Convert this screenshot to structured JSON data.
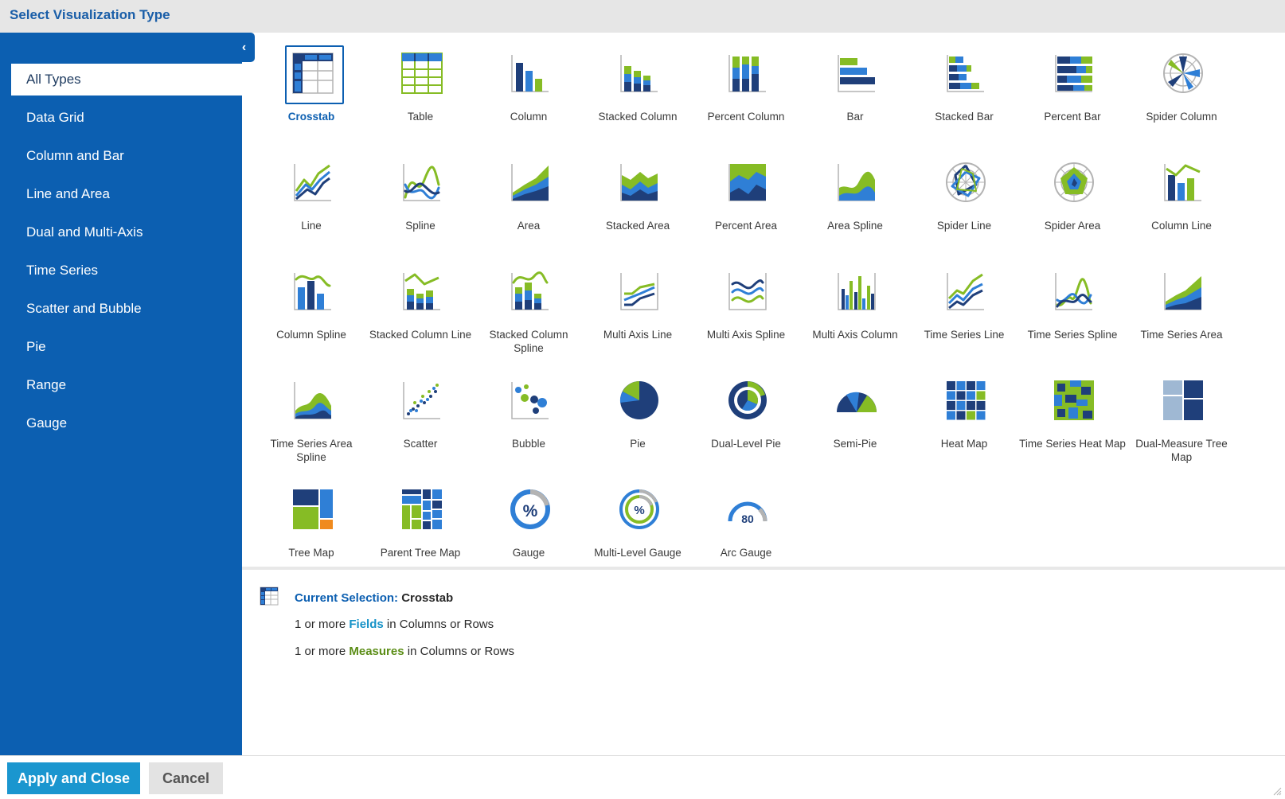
{
  "window": {
    "title": "Select Visualization Type"
  },
  "sidebar": {
    "collapse_glyph": "‹",
    "items": [
      {
        "label": "All Types",
        "active": true
      },
      {
        "label": "Data Grid"
      },
      {
        "label": "Column and Bar"
      },
      {
        "label": "Line and Area"
      },
      {
        "label": "Dual and Multi-Axis"
      },
      {
        "label": "Time Series"
      },
      {
        "label": "Scatter and Bubble"
      },
      {
        "label": "Pie"
      },
      {
        "label": "Range"
      },
      {
        "label": "Gauge"
      }
    ]
  },
  "gallery": {
    "items": [
      {
        "label": "Crosstab",
        "icon": "crosstab-icon",
        "selected": true
      },
      {
        "label": "Table",
        "icon": "table-icon"
      },
      {
        "label": "Column",
        "icon": "column-chart-icon"
      },
      {
        "label": "Stacked Column",
        "icon": "stacked-column-icon"
      },
      {
        "label": "Percent Column",
        "icon": "percent-column-icon"
      },
      {
        "label": "Bar",
        "icon": "bar-chart-icon"
      },
      {
        "label": "Stacked Bar",
        "icon": "stacked-bar-icon"
      },
      {
        "label": "Percent Bar",
        "icon": "percent-bar-icon"
      },
      {
        "label": "Spider Column",
        "icon": "spider-column-icon"
      },
      {
        "label": "Line",
        "icon": "line-chart-icon"
      },
      {
        "label": "Spline",
        "icon": "spline-chart-icon"
      },
      {
        "label": "Area",
        "icon": "area-chart-icon"
      },
      {
        "label": "Stacked Area",
        "icon": "stacked-area-icon"
      },
      {
        "label": "Percent Area",
        "icon": "percent-area-icon"
      },
      {
        "label": "Area Spline",
        "icon": "area-spline-icon"
      },
      {
        "label": "Spider Line",
        "icon": "spider-line-icon"
      },
      {
        "label": "Spider Area",
        "icon": "spider-area-icon"
      },
      {
        "label": "Column Line",
        "icon": "column-line-icon"
      },
      {
        "label": "Column Spline",
        "icon": "column-spline-icon"
      },
      {
        "label": "Stacked Column Line",
        "icon": "stacked-column-line-icon"
      },
      {
        "label": "Stacked Column Spline",
        "icon": "stacked-column-spline-icon"
      },
      {
        "label": "Multi Axis Line",
        "icon": "multi-axis-line-icon"
      },
      {
        "label": "Multi Axis Spline",
        "icon": "multi-axis-spline-icon"
      },
      {
        "label": "Multi Axis Column",
        "icon": "multi-axis-column-icon"
      },
      {
        "label": "Time Series Line",
        "icon": "time-series-line-icon"
      },
      {
        "label": "Time Series Spline",
        "icon": "time-series-spline-icon"
      },
      {
        "label": "Time Series Area",
        "icon": "time-series-area-icon"
      },
      {
        "label": "Time Series Area Spline",
        "icon": "time-series-area-spline-icon"
      },
      {
        "label": "Scatter",
        "icon": "scatter-chart-icon"
      },
      {
        "label": "Bubble",
        "icon": "bubble-chart-icon"
      },
      {
        "label": "Pie",
        "icon": "pie-chart-icon"
      },
      {
        "label": "Dual-Level Pie",
        "icon": "dual-level-pie-icon"
      },
      {
        "label": "Semi-Pie",
        "icon": "semi-pie-icon"
      },
      {
        "label": "Heat Map",
        "icon": "heat-map-icon"
      },
      {
        "label": "Time Series Heat Map",
        "icon": "time-series-heat-map-icon"
      },
      {
        "label": "Dual-Measure Tree Map",
        "icon": "dual-measure-tree-map-icon"
      },
      {
        "label": "Tree Map",
        "icon": "tree-map-icon"
      },
      {
        "label": "Parent Tree Map",
        "icon": "parent-tree-map-icon"
      },
      {
        "label": "Gauge",
        "icon": "gauge-icon",
        "glyph": "%"
      },
      {
        "label": "Multi-Level Gauge",
        "icon": "multi-level-gauge-icon",
        "glyph": "%"
      },
      {
        "label": "Arc Gauge",
        "icon": "arc-gauge-icon",
        "glyph": "80"
      }
    ]
  },
  "details": {
    "selection_key": "Current Selection:",
    "selection_value": "Crosstab",
    "req1": {
      "prefix": "1 or more",
      "term": "Fields",
      "suffix": "in Columns or Rows"
    },
    "req2": {
      "prefix": "1 or more",
      "term": "Measures",
      "suffix": "in Columns or Rows"
    }
  },
  "footer": {
    "apply_label": "Apply and Close",
    "cancel_label": "Cancel"
  },
  "colors": {
    "brand_blue": "#0c5fb1",
    "dark_blue": "#1f3f7a",
    "mid_blue": "#2f7fd6",
    "green": "#86bc25",
    "orange": "#f08a1d",
    "gray": "#b3b3b3"
  }
}
